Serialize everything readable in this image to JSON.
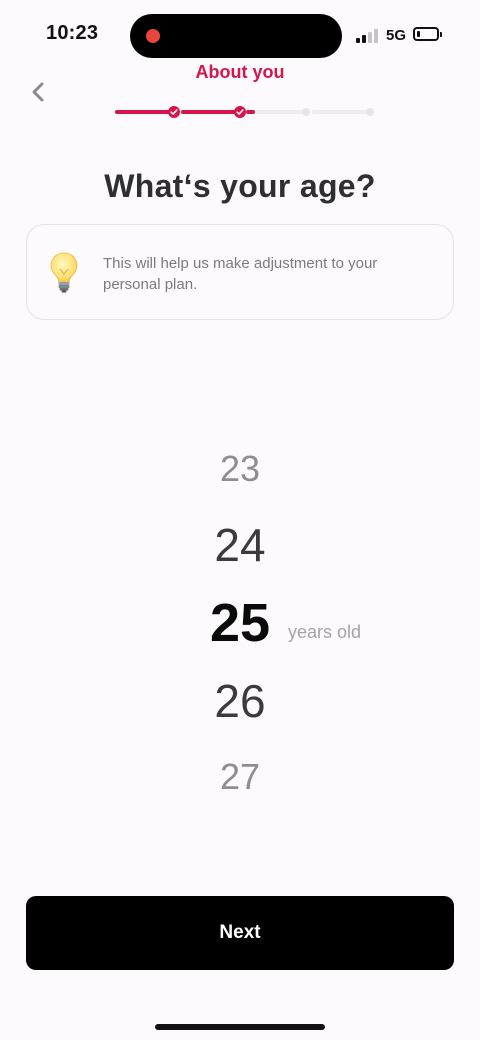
{
  "status_bar": {
    "time": "10:23",
    "network": "5G",
    "signal_bars_active": 2,
    "battery_level": 0.15,
    "recording_color": "#e8453c"
  },
  "header": {
    "section_title": "About you",
    "back_icon": "chevron-left-icon",
    "accent_color": "#d4154a",
    "progress": {
      "segments_fill": [
        1,
        1,
        0.15,
        0
      ],
      "completed_steps": 2,
      "total_steps": 4
    }
  },
  "main": {
    "title": "What‘s your age?",
    "info_card": {
      "icon": "lightbulb-icon",
      "text": "This will help us make adjustment to your personal plan."
    },
    "age_picker": {
      "options": [
        "23",
        "24",
        "25",
        "26",
        "27"
      ],
      "selected": "25",
      "unit": "years old"
    }
  },
  "footer": {
    "next_label": "Next"
  }
}
